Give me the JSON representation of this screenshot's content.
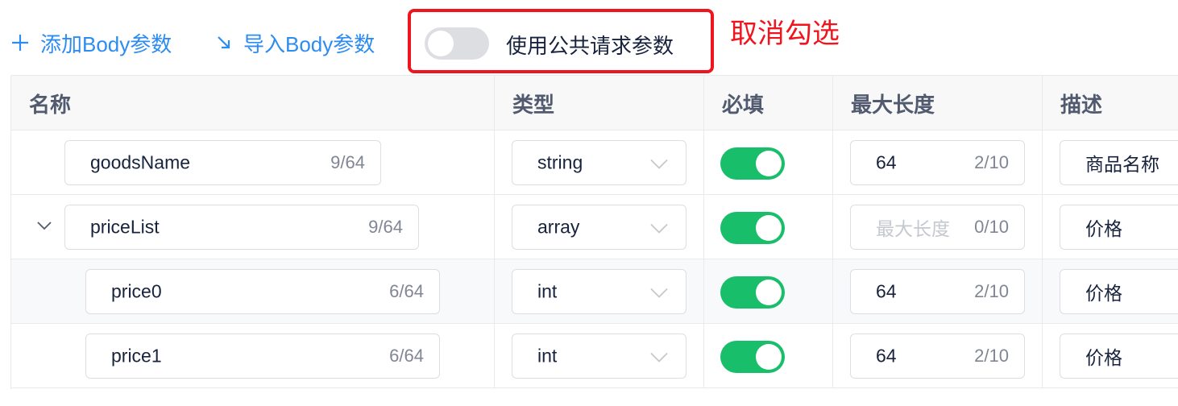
{
  "toolbar": {
    "add_label": "添加Body参数",
    "add_icon": "plus-icon",
    "import_label": "导入Body参数",
    "import_icon": "arrow-down-right-icon",
    "public_switch_label": "使用公共请求参数",
    "public_switch_on": false
  },
  "annotation": {
    "text": "取消勾选",
    "color": "#f0141e"
  },
  "colors": {
    "primary": "#2d8cf0",
    "switch_on": "#19be6b",
    "switch_off": "#dcdee2",
    "highlight": "#f0141e"
  },
  "table": {
    "columns": [
      "名称",
      "类型",
      "必填",
      "最大长度",
      "描述"
    ],
    "rows": [
      {
        "name": "goodsName",
        "name_count": "9/64",
        "type": "string",
        "required": true,
        "max_value": "64",
        "max_placeholder": "",
        "max_count": "2/10",
        "desc": "商品名称",
        "level": 0,
        "expandable": false
      },
      {
        "name": "priceList",
        "name_count": "9/64",
        "type": "array",
        "required": true,
        "max_value": "",
        "max_placeholder": "最大长度",
        "max_count": "0/10",
        "desc": "价格",
        "level": 0,
        "expandable": true
      },
      {
        "name": "price0",
        "name_count": "6/64",
        "type": "int",
        "required": true,
        "max_value": "64",
        "max_placeholder": "",
        "max_count": "2/10",
        "desc": "价格",
        "level": 1,
        "expandable": false
      },
      {
        "name": "price1",
        "name_count": "6/64",
        "type": "int",
        "required": true,
        "max_value": "64",
        "max_placeholder": "",
        "max_count": "2/10",
        "desc": "价格",
        "level": 1,
        "expandable": false
      }
    ]
  }
}
